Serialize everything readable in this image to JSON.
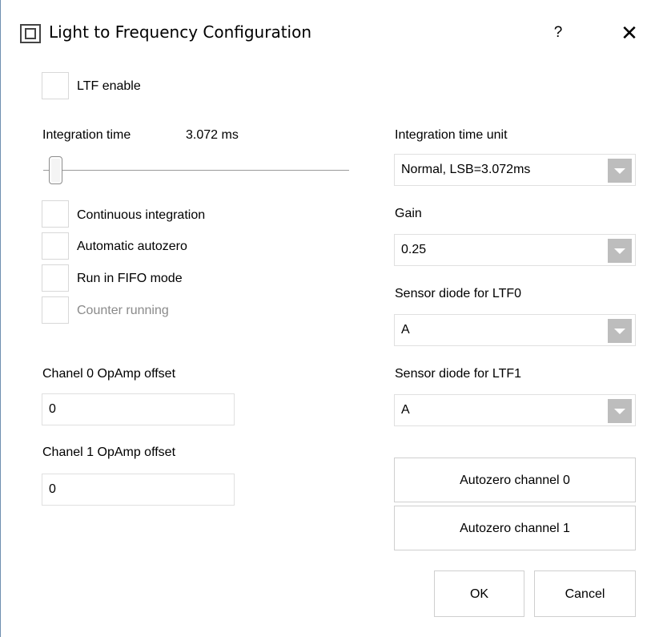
{
  "window": {
    "title": "Light to Frequency Configuration",
    "help_label": "?",
    "close_label": "✕"
  },
  "ltf_enable": {
    "label": "LTF enable",
    "checked": false
  },
  "integration": {
    "label": "Integration time",
    "value": "3.072 ms",
    "slider_level": 0.02
  },
  "checkboxes": [
    {
      "label": "Continuous integration",
      "checked": false,
      "enabled": true
    },
    {
      "label": "Automatic autozero",
      "checked": false,
      "enabled": true
    },
    {
      "label": "Run in FIFO mode",
      "checked": false,
      "enabled": true
    },
    {
      "label": "Counter running",
      "checked": false,
      "enabled": false
    }
  ],
  "offsets": {
    "ch0": {
      "label": "Chanel 0 OpAmp offset",
      "value": "0"
    },
    "ch1": {
      "label": "Chanel 1 OpAmp offset",
      "value": "0"
    }
  },
  "right": {
    "unit": {
      "label": "Integration time unit",
      "value": "Normal, LSB=3.072ms"
    },
    "gain": {
      "label": "Gain",
      "value": "0.25"
    },
    "ltf0": {
      "label": "Sensor diode for LTF0",
      "value": "A"
    },
    "ltf1": {
      "label": "Sensor diode for LTF1",
      "value": "A"
    }
  },
  "buttons": {
    "autozero0": "Autozero channel 0",
    "autozero1": "Autozero channel 1",
    "ok": "OK",
    "cancel": "Cancel"
  }
}
